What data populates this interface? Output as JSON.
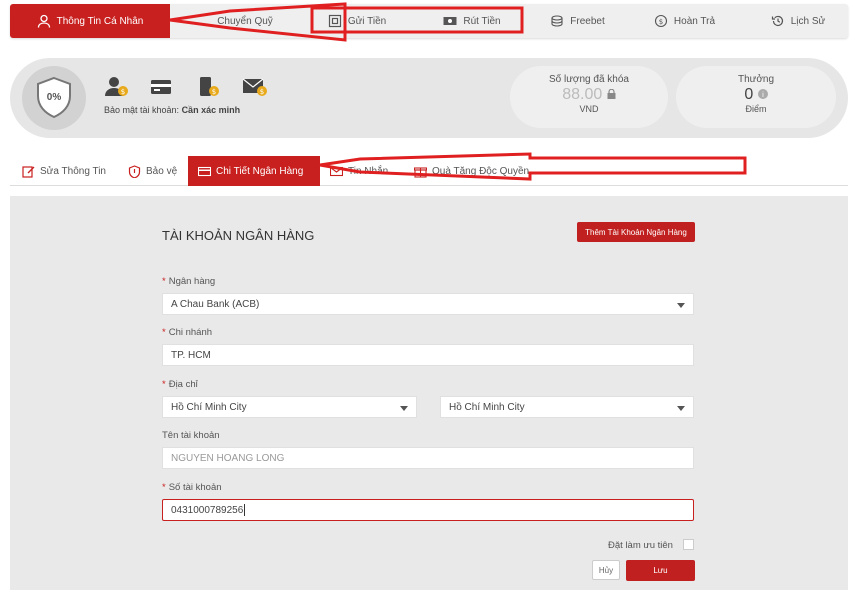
{
  "topnav": {
    "items": [
      {
        "label": "Thông Tin Cá Nhân",
        "icon": "user-icon"
      },
      {
        "label": "Chuyển Quỹ",
        "icon": "transfer-icon"
      },
      {
        "label": "Gửi Tiền",
        "icon": "deposit-icon"
      },
      {
        "label": "Rút Tiền",
        "icon": "withdraw-icon"
      },
      {
        "label": "Freebet",
        "icon": "coins-icon"
      },
      {
        "label": "Hoàn Trả",
        "icon": "refund-icon"
      },
      {
        "label": "Lịch Sử",
        "icon": "history-icon"
      }
    ]
  },
  "profile": {
    "security_percent": "0%",
    "security_label": "Bảo mật tài khoản:",
    "security_status": "Cần xác minh",
    "locked_title": "Số lượng đã khóa",
    "locked_value": "88.00",
    "locked_unit": "VND",
    "reward_title": "Thưởng",
    "reward_value": "0",
    "reward_unit": "Điểm"
  },
  "subtabs": [
    {
      "label": "Sửa Thông Tin",
      "icon": "edit-icon"
    },
    {
      "label": "Bảo vệ",
      "icon": "shield-icon"
    },
    {
      "label": "Chi Tiết Ngân Hàng",
      "icon": "bank-card-icon"
    },
    {
      "label": "Tin Nhắn",
      "icon": "mail-icon"
    },
    {
      "label": "Quà Tặng Độc Quyền",
      "icon": "gift-icon"
    }
  ],
  "form": {
    "title": "TÀI KHOẢN NGÂN HÀNG",
    "add_button": "Thêm Tài Khoản Ngân Hàng",
    "bank_label": "Ngân hàng",
    "bank_value": "A Chau Bank (ACB)",
    "branch_label": "Chi nhánh",
    "branch_value": "TP. HCM",
    "address_label": "Địa chỉ",
    "province_value": "Hồ Chí Minh City",
    "city_value": "Hồ Chí Minh City",
    "account_name_label": "Tên tài khoản",
    "account_name_value": "NGUYEN HOANG LONG",
    "account_number_label": "Số tài khoản",
    "account_number_value": "0431000789256",
    "default_label": "Đặt làm ưu tiên",
    "cancel_button": "Hủy",
    "save_button": "Lưu"
  },
  "colors": {
    "accent": "#c8201f",
    "annotation": "#e02020"
  }
}
